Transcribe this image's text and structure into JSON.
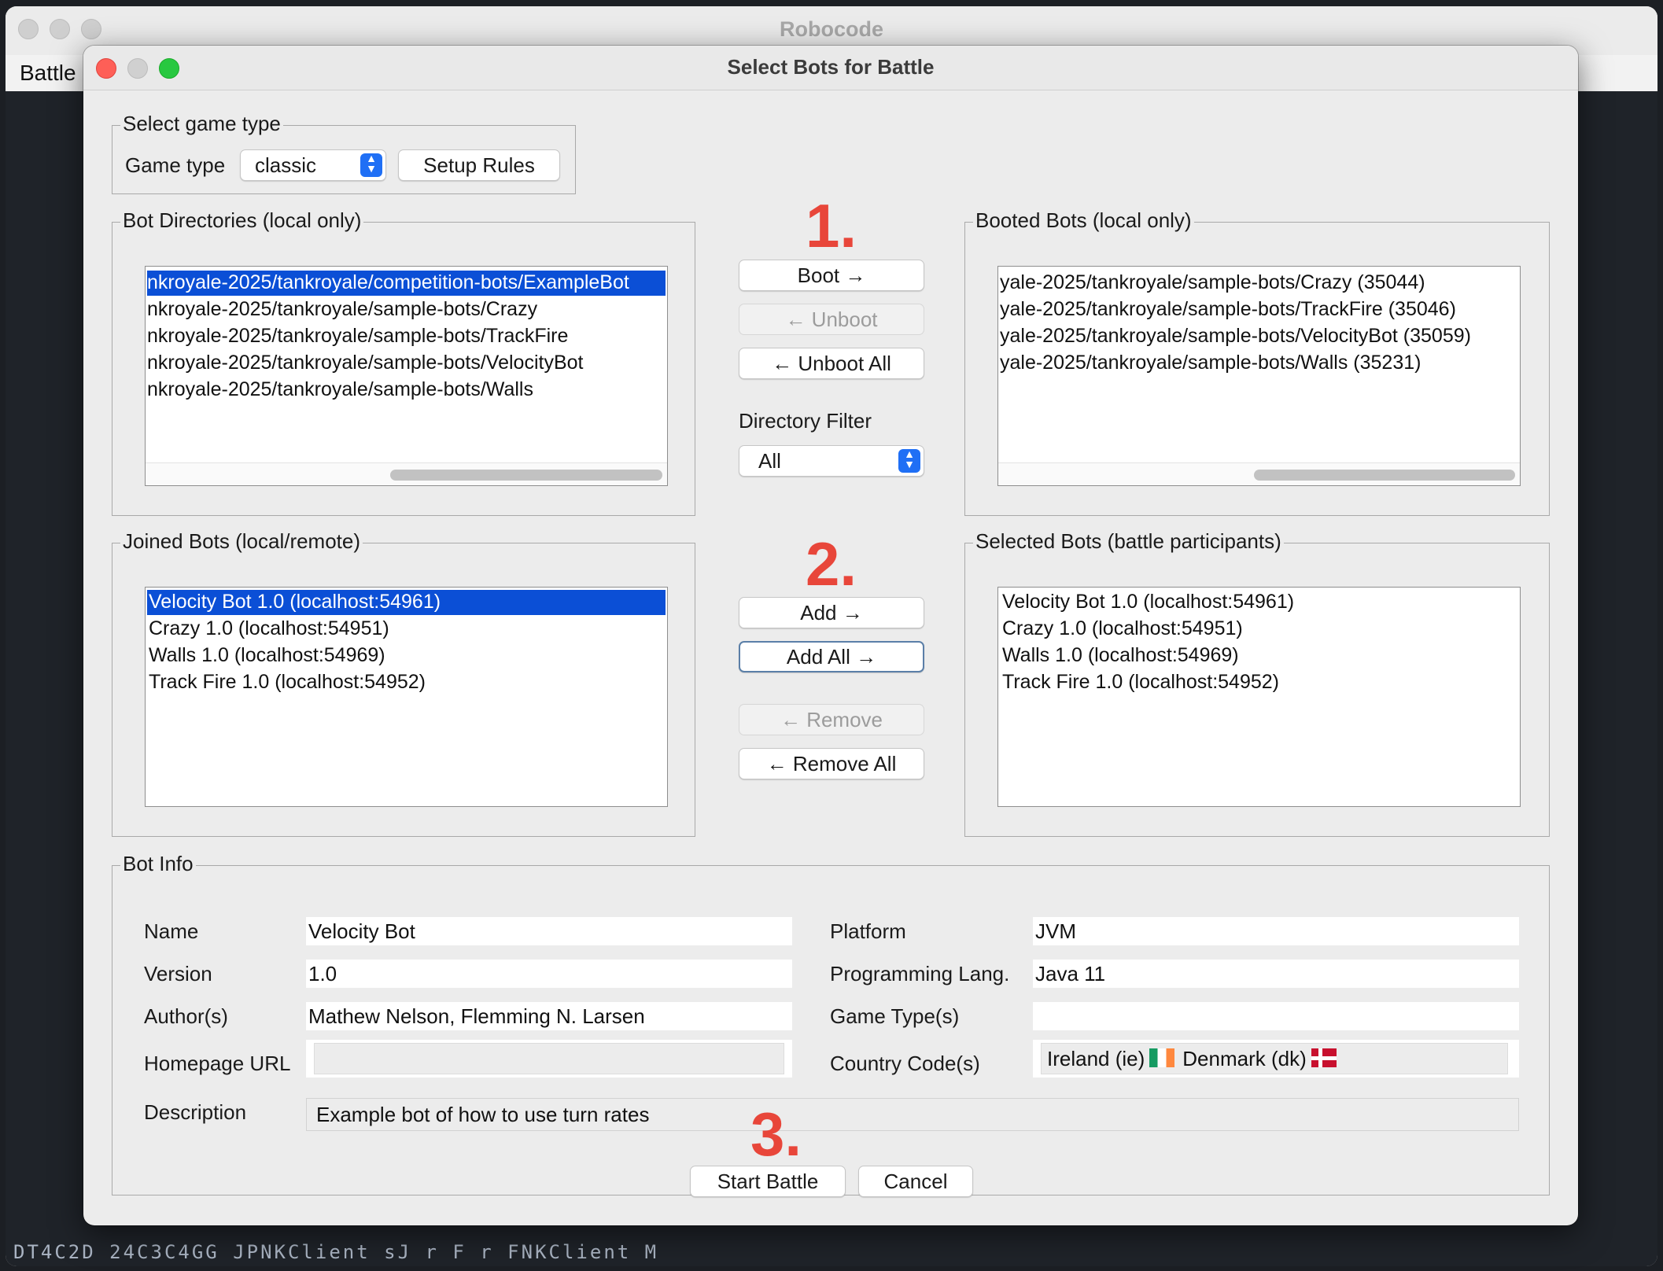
{
  "app": {
    "title": "Robocode",
    "menu": [
      "Battle"
    ],
    "console_text": "DT4C2D    24C3C4GG    JPNKClient    sJ    r    F    r    FNKClient    M    "
  },
  "dialog": {
    "title": "Select Bots for Battle",
    "game_type_group": {
      "title": "Select game type",
      "label": "Game type",
      "value": "classic",
      "setup_rules_label": "Setup Rules"
    },
    "bot_directories": {
      "title": "Bot Directories (local only)",
      "items": [
        "nkroyale-2025/tankroyale/competition-bots/ExampleBot",
        "nkroyale-2025/tankroyale/sample-bots/Crazy",
        "nkroyale-2025/tankroyale/sample-bots/TrackFire",
        "nkroyale-2025/tankroyale/sample-bots/VelocityBot",
        "nkroyale-2025/tankroyale/sample-bots/Walls"
      ],
      "selected_index": 0
    },
    "booted_bots": {
      "title": "Booted Bots (local only)",
      "items": [
        "yale-2025/tankroyale/sample-bots/Crazy (35044)",
        "yale-2025/tankroyale/sample-bots/TrackFire (35046)",
        "yale-2025/tankroyale/sample-bots/VelocityBot (35059)",
        "yale-2025/tankroyale/sample-bots/Walls (35231)"
      ]
    },
    "step_labels": [
      "1.",
      "2.",
      "3."
    ],
    "boot_buttons": {
      "boot": "Boot →",
      "unboot": "← Unboot",
      "unboot_all": "← Unboot All"
    },
    "directory_filter": {
      "label": "Directory Filter",
      "value": "All"
    },
    "joined_bots": {
      "title": "Joined Bots (local/remote)",
      "items": [
        "Velocity Bot 1.0 (localhost:54961)",
        "Crazy 1.0 (localhost:54951)",
        "Walls 1.0 (localhost:54969)",
        "Track Fire 1.0 (localhost:54952)"
      ],
      "selected_index": 0
    },
    "selected_bots": {
      "title": "Selected Bots (battle participants)",
      "items": [
        "Velocity Bot 1.0 (localhost:54961)",
        "Crazy 1.0 (localhost:54951)",
        "Walls 1.0 (localhost:54969)",
        "Track Fire 1.0 (localhost:54952)"
      ]
    },
    "add_buttons": {
      "add": "Add →",
      "add_all": "Add All →",
      "remove": "← Remove",
      "remove_all": "← Remove All"
    },
    "bot_info": {
      "title": "Bot Info",
      "name_label": "Name",
      "name": "Velocity Bot",
      "version_label": "Version",
      "version": "1.0",
      "authors_label": "Author(s)",
      "authors": "Mathew Nelson, Flemming N. Larsen",
      "homepage_label": "Homepage URL",
      "homepage": "",
      "description_label": "Description",
      "description": "Example bot of how to use turn rates",
      "platform_label": "Platform",
      "platform": "JVM",
      "lang_label": "Programming Lang.",
      "lang": "Java 11",
      "game_types_label": "Game Type(s)",
      "game_types": "",
      "country_label": "Country Code(s)",
      "countries": [
        {
          "name": "Ireland (ie)",
          "flag": "ie-flag-icon"
        },
        {
          "name": "Denmark (dk)",
          "flag": "dk-flag-icon"
        }
      ]
    },
    "footer": {
      "start_battle": "Start Battle",
      "cancel": "Cancel"
    }
  },
  "colors": {
    "selection": "#0b4fd6",
    "step_red": "#e8463a",
    "combo_blue": "#1f6ff5"
  }
}
